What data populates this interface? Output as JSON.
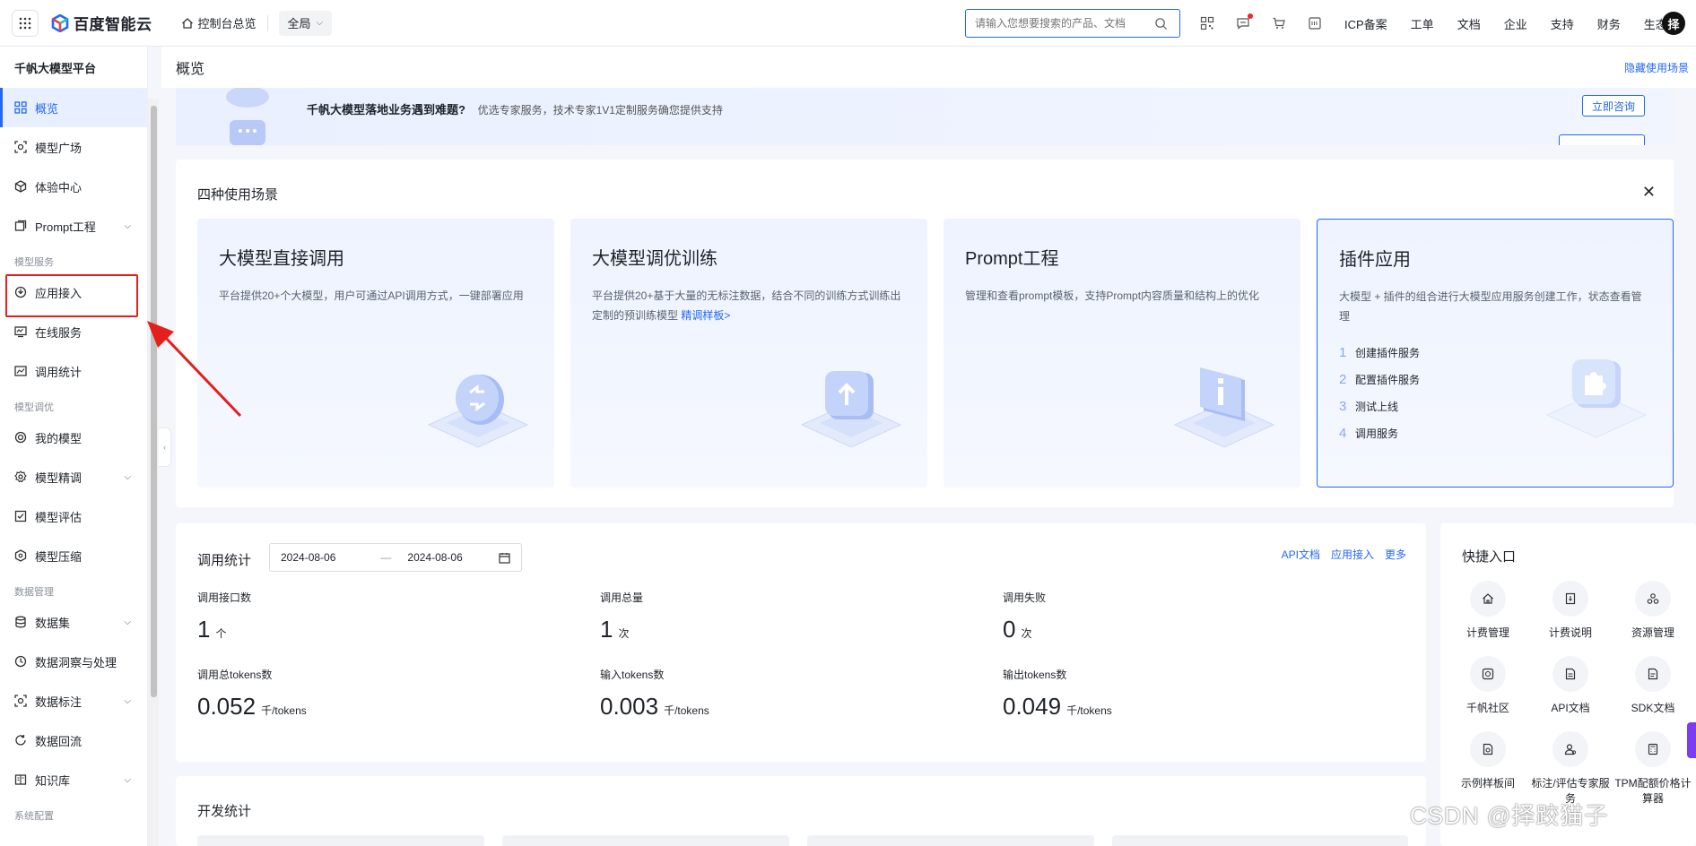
{
  "topbar": {
    "brand": "百度智能云",
    "console_home": "控制台总览",
    "region": "全局",
    "search_placeholder": "请输入您想要搜索的产品、文档",
    "links": [
      "ICP备案",
      "工单",
      "文档",
      "企业",
      "支持",
      "财务",
      "生态"
    ],
    "avatar": "择"
  },
  "sidebar": {
    "title": "千帆大模型平台",
    "items_top": [
      {
        "label": "概览",
        "icon": "grid-icon",
        "active": true
      },
      {
        "label": "模型广场",
        "icon": "model-square-icon"
      },
      {
        "label": "体验中心",
        "icon": "cube-icon"
      },
      {
        "label": "Prompt工程",
        "icon": "prompt-icon",
        "expandable": true
      }
    ],
    "group_service": "模型服务",
    "items_service": [
      {
        "label": "应用接入",
        "icon": "app-access-icon"
      },
      {
        "label": "在线服务",
        "icon": "monitor-icon"
      },
      {
        "label": "调用统计",
        "icon": "chart-icon"
      }
    ],
    "group_tune": "模型调优",
    "items_tune": [
      {
        "label": "我的模型",
        "icon": "target-icon"
      },
      {
        "label": "模型精调",
        "icon": "gear-icon",
        "expandable": true
      },
      {
        "label": "模型评估",
        "icon": "evaluate-icon"
      },
      {
        "label": "模型压缩",
        "icon": "compress-icon"
      }
    ],
    "group_data": "数据管理",
    "items_data": [
      {
        "label": "数据集",
        "icon": "database-icon",
        "expandable": true
      },
      {
        "label": "数据洞察与处理",
        "icon": "insight-icon"
      },
      {
        "label": "数据标注",
        "icon": "annotate-icon",
        "expandable": true
      },
      {
        "label": "数据回流",
        "icon": "reflow-icon"
      },
      {
        "label": "知识库",
        "icon": "book-icon",
        "expandable": true
      }
    ],
    "group_system": "系统配置"
  },
  "page": {
    "title": "概览",
    "hide_scene": "隐藏使用场景"
  },
  "promo": {
    "title": "千帆大模型落地业务遇到难题?",
    "desc": "优选专家服务，技术专家1V1定制服务确您提供支持",
    "button": "立即咨询"
  },
  "scenes": {
    "title": "四种使用场景",
    "cards": [
      {
        "title": "大模型直接调用",
        "desc": "平台提供20+个大模型，用户可通过API调用方式，一键部署应用"
      },
      {
        "title": "大模型调优训练",
        "desc": "平台提供20+基于大量的无标注数据，结合不同的训练方式训练出定制的预训练模型",
        "link": "精调样板>"
      },
      {
        "title": "Prompt工程",
        "desc": "管理和查看prompt模板，支持Prompt内容质量和结构上的优化"
      },
      {
        "title": "插件应用",
        "desc": "大模型 + 插件的组合进行大模型应用服务创建工作，状态查看管理",
        "steps": [
          "创建插件服务",
          "配置插件服务",
          "测试上线",
          "调用服务"
        ]
      }
    ]
  },
  "stats": {
    "title": "调用统计",
    "date_start": "2024-08-06",
    "date_end": "2024-08-06",
    "date_sep": "—",
    "links": [
      "API文档",
      "应用接入",
      "更多"
    ],
    "metrics": [
      {
        "label": "调用接口数",
        "value": "1",
        "unit": "个"
      },
      {
        "label": "调用总量",
        "value": "1",
        "unit": "次"
      },
      {
        "label": "调用失败",
        "value": "0",
        "unit": "次"
      },
      {
        "label": "调用总tokens数",
        "value": "0.052",
        "unit": "千/tokens"
      },
      {
        "label": "输入tokens数",
        "value": "0.003",
        "unit": "千/tokens"
      },
      {
        "label": "输出tokens数",
        "value": "0.049",
        "unit": "千/tokens"
      }
    ]
  },
  "quick": {
    "title": "快捷入口",
    "items": [
      {
        "label": "计费管理",
        "icon": "home-icon"
      },
      {
        "label": "计费说明",
        "icon": "bill-icon"
      },
      {
        "label": "资源管理",
        "icon": "resource-icon"
      },
      {
        "label": "千帆社区",
        "icon": "community-icon"
      },
      {
        "label": "API文档",
        "icon": "doc-icon"
      },
      {
        "label": "SDK文档",
        "icon": "sdk-doc-icon"
      },
      {
        "label": "示例样板间",
        "icon": "sample-icon"
      },
      {
        "label": "标注/评估专家服务",
        "icon": "expert-icon"
      },
      {
        "label": "TPM配额价格计算器",
        "icon": "calculator-icon"
      }
    ]
  },
  "dev": {
    "title": "开发统计"
  },
  "watermark": "CSDN @择跤猫子"
}
